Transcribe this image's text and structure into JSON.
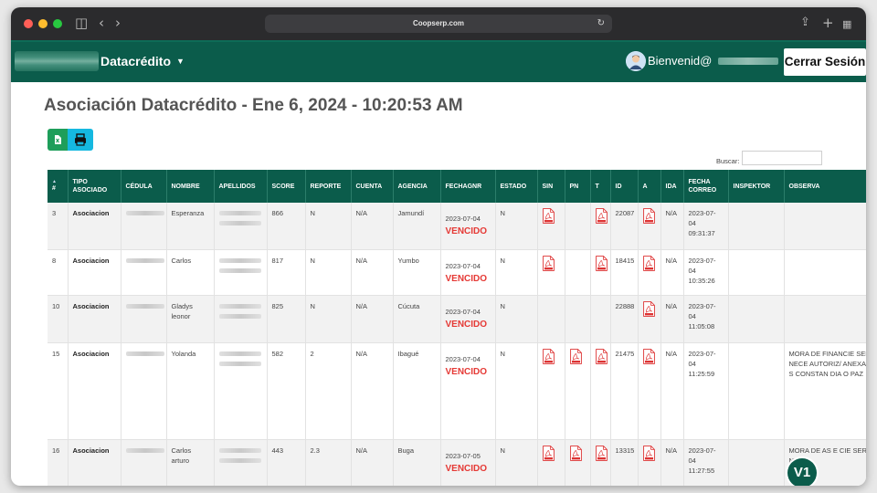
{
  "browser": {
    "url": "Coopserp.com"
  },
  "nav": {
    "brand": "Datacrédito",
    "welcome": "Bienvenid@",
    "logout_label": "Cerrar Sesión"
  },
  "page": {
    "title": "Asociación Datacrédito - Ene 6, 2024 - 10:20:53 AM",
    "search_label": "Buscar:"
  },
  "table": {
    "headers": {
      "num": "#",
      "tipo": "TIPO ASOCIADO",
      "cedula": "CÉDULA",
      "nombre": "NOMBRE",
      "apellidos": "APELLIDOS",
      "score": "SCORE",
      "reporte": "REPORTE",
      "cuenta": "CUENTA",
      "agencia": "AGENCIA",
      "fechagnr": "FECHAGNR",
      "estado": "ESTADO",
      "sin": "SIN",
      "pn": "PN",
      "t": "T",
      "id": "ID",
      "a": "A",
      "ida": "IDA",
      "fecha_correo": "FECHA CORREO",
      "inspektor": "INSPEKTOR",
      "observa": "OBSERVA"
    },
    "rows": [
      {
        "num": "3",
        "tipo": "Asociacion",
        "nombre": "Esperanza",
        "score": "866",
        "reporte": "N",
        "cuenta": "N/A",
        "agencia": "Jamundí",
        "fechagnr": "2023-07-04",
        "status": "VENCIDO",
        "estado": "N",
        "id": "22087",
        "ida": "N/A",
        "fecha_correo": "2023-07-04 09:31:37",
        "observa": ""
      },
      {
        "num": "8",
        "tipo": "Asociacion",
        "nombre": "Carlos",
        "score": "817",
        "reporte": "N",
        "cuenta": "N/A",
        "agencia": "Yumbo",
        "fechagnr": "2023-07-04",
        "status": "VENCIDO",
        "estado": "N",
        "id": "18415",
        "ida": "N/A",
        "fecha_correo": "2023-07-04 10:35:26",
        "observa": ""
      },
      {
        "num": "10",
        "tipo": "Asociacion",
        "nombre": "Gladys leonor",
        "score": "825",
        "reporte": "N",
        "cuenta": "N/A",
        "agencia": "Cúcuta",
        "fechagnr": "2023-07-04",
        "status": "VENCIDO",
        "estado": "N",
        "id": "22888",
        "ida": "N/A",
        "fecha_correo": "2023-07-04 11:05:08",
        "observa": ""
      },
      {
        "num": "15",
        "tipo": "Asociacion",
        "nombre": "Yolanda",
        "score": "582",
        "reporte": "2",
        "cuenta": "N/A",
        "agencia": "Ibagué",
        "fechagnr": "2023-07-04",
        "status": "VENCIDO",
        "estado": "N",
        "id": "21475",
        "ida": "N/A",
        "fecha_correo": "2023-07-04 11:25:59",
        "observa": "MORA DE FINANCIE SER NECE AUTORIZ/ ANEXAR S CONSTAN DIA O PAZ"
      },
      {
        "num": "16",
        "tipo": "Asociacion",
        "nombre": "Carlos arturo",
        "score": "443",
        "reporte": "2.3",
        "cuenta": "N/A",
        "agencia": "Buga",
        "fechagnr": "2023-07-05",
        "status": "VENCIDO",
        "estado": "N",
        "id": "13315",
        "ida": "N/A",
        "fecha_correo": "2023-07-04 11:27:55",
        "observa": "MORA DE AS E CIE SER NECE"
      }
    ]
  },
  "badge": "V1"
}
